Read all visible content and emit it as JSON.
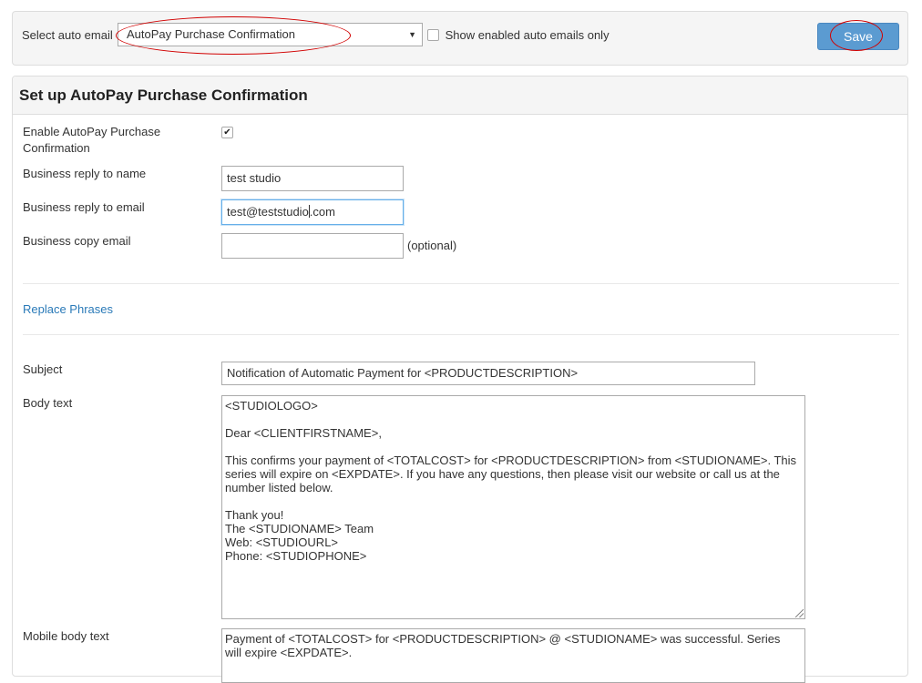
{
  "topbar": {
    "select_label": "Select auto email",
    "selected_email": "AutoPay Purchase Confirmation",
    "show_enabled_label": "Show enabled auto emails only",
    "save_label": "Save"
  },
  "panel": {
    "title": "Set up AutoPay Purchase Confirmation",
    "enable_label": "Enable AutoPay Purchase Confirmation",
    "enable_checked": true,
    "reply_name_label": "Business reply to name",
    "reply_name_value": "test studio",
    "reply_email_label": "Business reply to email",
    "reply_email_value_before_cursor": "test@teststudio",
    "reply_email_value_after_cursor": ".com",
    "copy_email_label": "Business copy email",
    "copy_email_value": "",
    "optional_note": "(optional)",
    "replace_phrases_link": "Replace Phrases",
    "subject_label": "Subject",
    "subject_value": "Notification of Automatic Payment for <PRODUCTDESCRIPTION>",
    "body_label": "Body text",
    "body_lines": [
      "<STUDIOLOGO>",
      "",
      "Dear <CLIENTFIRSTNAME>,",
      "",
      "This confirms your payment of <TOTALCOST> for <PRODUCTDESCRIPTION> from <STUDIONAME>. This",
      "series will expire on <EXPDATE>. If you have any questions, then please visit our website or call us at the",
      "number listed below.",
      "",
      "Thank you!",
      "The <STUDIONAME> Team",
      "Web: <STUDIOURL>",
      "Phone: <STUDIOPHONE>"
    ],
    "mobile_body_label": "Mobile body text",
    "mobile_body_lines": [
      "Payment of <TOTALCOST> for <PRODUCTDESCRIPTION> @ <STUDIONAME> was successful. Series",
      "will expire <EXPDATE>."
    ]
  },
  "icons": {
    "dropdown": "caret-down-icon",
    "check": "checkmark-icon",
    "resize": "resize-grip-icon"
  },
  "colors": {
    "primary_button": "#5b9bd1",
    "link": "#2a7ab8",
    "annotation_ring": "#d10000",
    "focus_border": "#66afe9"
  }
}
